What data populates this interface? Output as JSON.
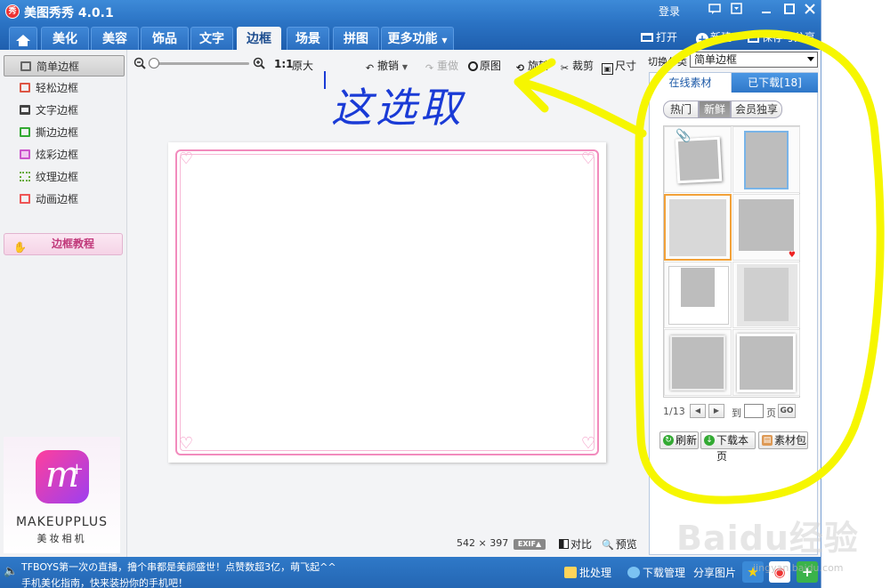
{
  "app": {
    "title": "美图秀秀 4.0.1",
    "logo_text": "秀",
    "login": "登录"
  },
  "nav": {
    "tabs": [
      "美化",
      "美容",
      "饰品",
      "文字",
      "边框",
      "场景",
      "拼图",
      "更多功能"
    ],
    "active": "边框",
    "open": "打开",
    "new": "新建",
    "save_share": "保存与分享"
  },
  "sidebar": {
    "items": [
      "简单边框",
      "轻松边框",
      "文字边框",
      "撕边边框",
      "炫彩边框",
      "纹理边框",
      "动画边框"
    ],
    "active": "简单边框",
    "tutorial": "边框教程",
    "ad": {
      "title": "MAKEUPPLUS",
      "subtitle": "美妆相机",
      "logo_letter": "m"
    }
  },
  "toolbar": {
    "zoom_ratio": "1:1",
    "original_size": "原大",
    "undo": "撤销",
    "redo": "重做",
    "original": "原图",
    "rotate": "旋转",
    "crop": "裁剪",
    "size": "尺寸"
  },
  "canvas": {
    "image_width": "542",
    "image_height": "397",
    "exif": "EXIF",
    "compare": "对比",
    "preview": "预览"
  },
  "right_panel": {
    "category_label": "切换分类",
    "category_value": "简单边框",
    "tab_online": "在线素材",
    "tab_downloaded": "已下载[18]",
    "filters": [
      "热门",
      "新鲜",
      "会员独享"
    ],
    "active_filter": "新鲜",
    "pager": {
      "current": "1/13",
      "goto": "到",
      "page": "页",
      "go": "GO"
    },
    "actions": {
      "refresh": "刷新",
      "download_page": "下载本页",
      "material_pack": "素材包"
    }
  },
  "statusbar": {
    "news_line1": "TFBOYS第一次の直播，撸个串都是美颜盛世！点赞数超3亿，萌飞起^^",
    "news_line2": "手机美化指南，快来装扮你的手机吧！",
    "batch": "批处理",
    "download_manager": "下载管理",
    "share_image": "分享图片"
  },
  "annotation": {
    "handwriting": "这选取"
  },
  "watermark": {
    "text": "Baidu经验",
    "url": "jingyan.baidu.com"
  },
  "colors": {
    "titlebar": "#2a72c3",
    "frame_pink": "#f28bbd",
    "highlight_yellow": "#f6f600",
    "annotation_blue": "#1a3bd6",
    "selected_orange": "#f2a139"
  }
}
